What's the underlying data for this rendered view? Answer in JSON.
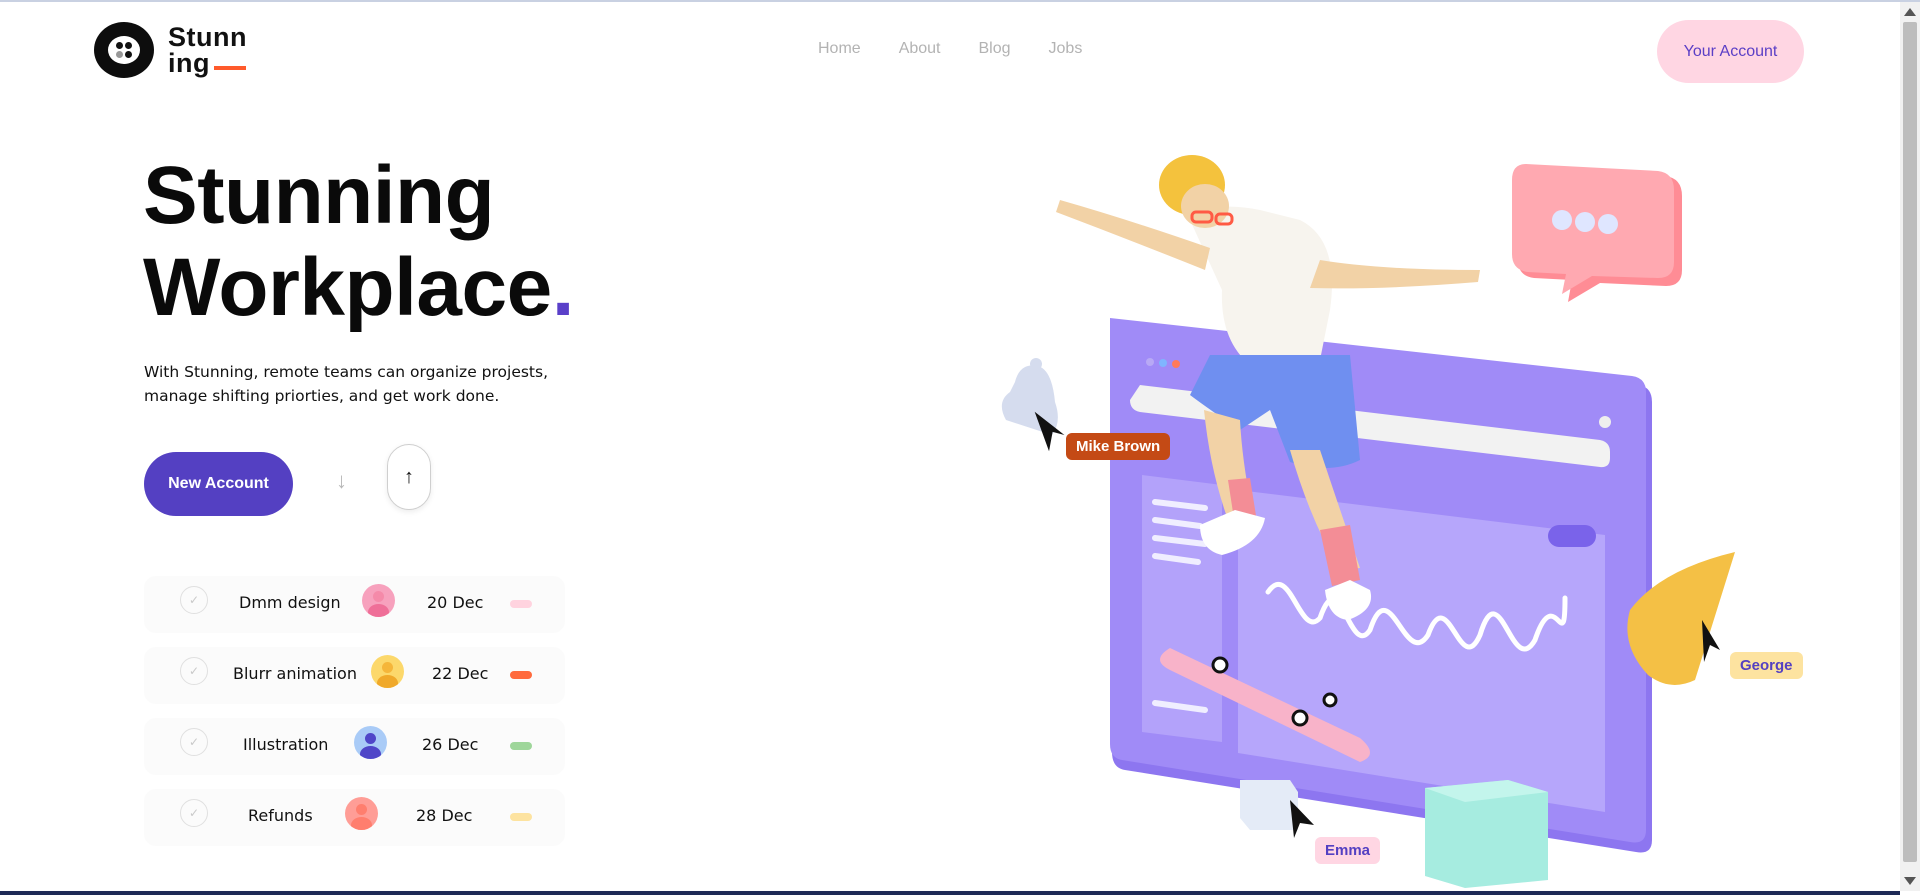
{
  "brand": {
    "name_line1": "Stunn",
    "name_line2": "ing",
    "accent": "#ff5a2b"
  },
  "nav": {
    "items": [
      "Home",
      "About",
      "Blog",
      "Jobs"
    ]
  },
  "header": {
    "account_label": "Your Account"
  },
  "hero": {
    "title_line1": "Stunning",
    "title_line2": "Workplace",
    "title_dot": ".",
    "description": "With Stunning, remote teams can organize projests, manage shifting priorties, and get work done.",
    "new_account_label": "New Account",
    "accent": "#5440c2"
  },
  "tasks": [
    {
      "name": "Dmm design",
      "date": "20 Dec",
      "avatar_color": "#f7a1bd",
      "status_color": "#ffd3df"
    },
    {
      "name": "Blurr animation",
      "date": "22 Dec",
      "avatar_color": "#fcd86b",
      "status_color": "#ff6a3d"
    },
    {
      "name": "Illustration",
      "date": "26 Dec",
      "avatar_color": "#a9cbf7",
      "status_color": "#9ed69a"
    },
    {
      "name": "Refunds",
      "date": "28 Dec",
      "avatar_color": "#ff9d96",
      "status_color": "#fde3a0"
    }
  ],
  "illustration": {
    "labels": [
      "Mike Brown",
      "George",
      "Emma"
    ]
  }
}
